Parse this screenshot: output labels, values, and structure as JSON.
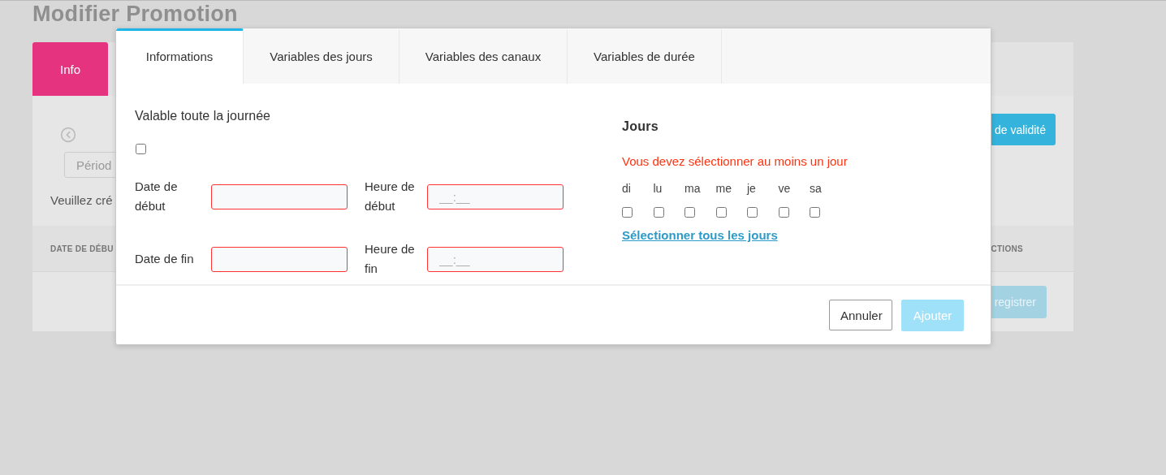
{
  "page": {
    "title": "Modifier Promotion",
    "tabs": [
      {
        "label": "Info",
        "selected": true
      }
    ],
    "period_button": "Périod",
    "notice": "Veuillez cré",
    "validity_button": "de validité",
    "table": {
      "columns": [
        "DATE DE DÉBU",
        "CTIONS"
      ]
    },
    "save_button": "registrer"
  },
  "modal": {
    "tabs": [
      {
        "label": "Informations",
        "selected": true
      },
      {
        "label": "Variables des jours",
        "selected": false
      },
      {
        "label": "Variables des canaux",
        "selected": false
      },
      {
        "label": "Variables de durée",
        "selected": false
      }
    ],
    "all_day": {
      "label": "Valable toute la journée",
      "checked": false
    },
    "field_rows": [
      {
        "fields": [
          {
            "label": "Date de début",
            "invalid": true
          },
          {
            "label": "Heure de début",
            "invalid": true,
            "placeholder": "__:__"
          }
        ]
      },
      {
        "fields": [
          {
            "label": "Date de fin",
            "invalid": true
          },
          {
            "label": "Heure de fin",
            "invalid": true,
            "placeholder": "__:__"
          }
        ]
      }
    ],
    "days": {
      "title": "Jours",
      "error": "Vous devez sélectionner au moins un jour",
      "items": [
        {
          "label": "di",
          "checked": false
        },
        {
          "label": "lu",
          "checked": false
        },
        {
          "label": "ma",
          "checked": false
        },
        {
          "label": "me",
          "checked": false
        },
        {
          "label": "je",
          "checked": false
        },
        {
          "label": "ve",
          "checked": false
        },
        {
          "label": "sa",
          "checked": false
        }
      ],
      "select_all": "Sélectionner tous les jours"
    },
    "buttons": [
      {
        "label": "Annuler",
        "kind": "secondary"
      },
      {
        "label": "Ajouter",
        "kind": "primary",
        "disabled": true
      }
    ]
  }
}
